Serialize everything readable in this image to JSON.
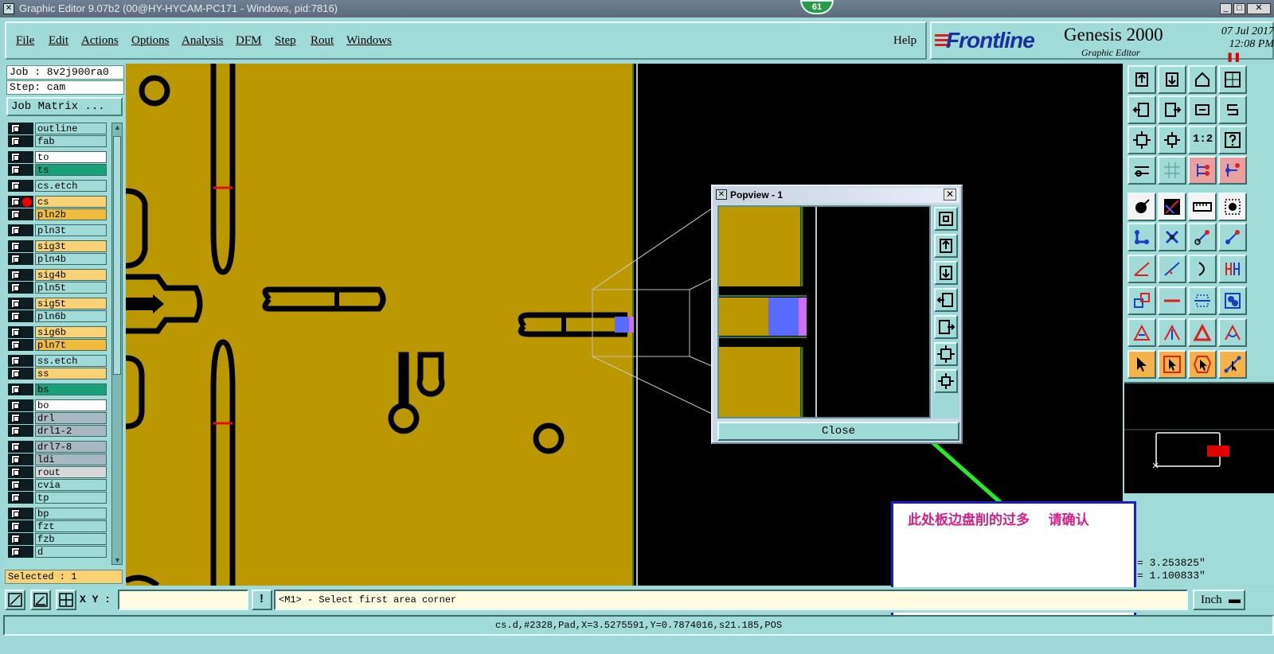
{
  "window": {
    "title": "Graphic Editor 9.07b2 (00@HY-HYCAM-PC171 - Windows, pid:7816)",
    "counter_badge": "61"
  },
  "menu": {
    "items": [
      "File",
      "Edit",
      "Actions",
      "Options",
      "Analysis",
      "DFM",
      "Step",
      "Rout",
      "Windows"
    ],
    "help": "Help"
  },
  "brand": {
    "logo": "Frontline",
    "product": "Genesis 2000",
    "subtitle": "Graphic Editor",
    "date": "07 Jul 2017",
    "time": "12:08 PM"
  },
  "left_panel": {
    "job": "Job : 8v2j900ra0",
    "step": "Step: cam",
    "job_matrix_button": "Job Matrix ...",
    "selected": "Selected : 1",
    "layers": [
      {
        "name": "outline",
        "color": "#a0dbd8"
      },
      {
        "name": "fab",
        "color": "#a0dbd8"
      },
      {
        "name": "to",
        "color": "#ffffff"
      },
      {
        "name": "ts",
        "color": "#18a078"
      },
      {
        "name": "cs.etch",
        "color": "#a0dbd8"
      },
      {
        "name": "cs",
        "color": "#f9d276",
        "active": true
      },
      {
        "name": "pln2b",
        "color": "#f0bc3e"
      },
      {
        "name": "pln3t",
        "color": "#a0dbd8"
      },
      {
        "name": "sig3t",
        "color": "#f9d276"
      },
      {
        "name": "pln4b",
        "color": "#a0dbd8"
      },
      {
        "name": "sig4b",
        "color": "#f9d276"
      },
      {
        "name": "pln5t",
        "color": "#a0dbd8"
      },
      {
        "name": "sig5t",
        "color": "#f9d276"
      },
      {
        "name": "pln6b",
        "color": "#a0dbd8"
      },
      {
        "name": "sig6b",
        "color": "#f9d276"
      },
      {
        "name": "pln7t",
        "color": "#f0bc3e"
      },
      {
        "name": "ss.etch",
        "color": "#a0dbd8"
      },
      {
        "name": "ss",
        "color": "#f9d276"
      },
      {
        "name": "bs",
        "color": "#18a078"
      },
      {
        "name": "bo",
        "color": "#ffffff"
      },
      {
        "name": "drl",
        "color": "#a8b8c0"
      },
      {
        "name": "drl1-2",
        "color": "#a8b8c0"
      },
      {
        "name": "drl7-8",
        "color": "#a8b8c0"
      },
      {
        "name": "ldi",
        "color": "#a8b8c0"
      },
      {
        "name": "rout",
        "color": "#d8d8d8"
      },
      {
        "name": "cvia",
        "color": "#a0dbd8"
      },
      {
        "name": "tp",
        "color": "#a0dbd8"
      },
      {
        "name": "bp",
        "color": "#a0dbd8"
      },
      {
        "name": "fzt",
        "color": "#a0dbd8"
      },
      {
        "name": "fzb",
        "color": "#a0dbd8"
      },
      {
        "name": "d",
        "color": "#a0dbd8"
      }
    ]
  },
  "right_panel": {
    "coord_x": "= 3.253825\"",
    "coord_y": "= 1.100833\"",
    "ratio_tool_label": "1:2"
  },
  "popview": {
    "title": "Popview - 1",
    "close_button": "Close"
  },
  "annotation": {
    "text": "此处板边盘削的过多    请确认"
  },
  "bottom": {
    "xy_label": "X Y :",
    "xy_value": "",
    "prompt": "<M1> - Select first area corner",
    "units": "Inch"
  },
  "status": {
    "text": "cs.d,#2328,Pad,X=3.5275591,Y=0.7874016,s21.185,POS"
  },
  "colors": {
    "copper": "#bc9800",
    "panel": "#a0dbd8",
    "selection": "#5a6cff",
    "highlight": "#d070f0",
    "arrow": "#22ee22",
    "note_border": "#1c1cc4",
    "note_text": "#d81f86"
  }
}
